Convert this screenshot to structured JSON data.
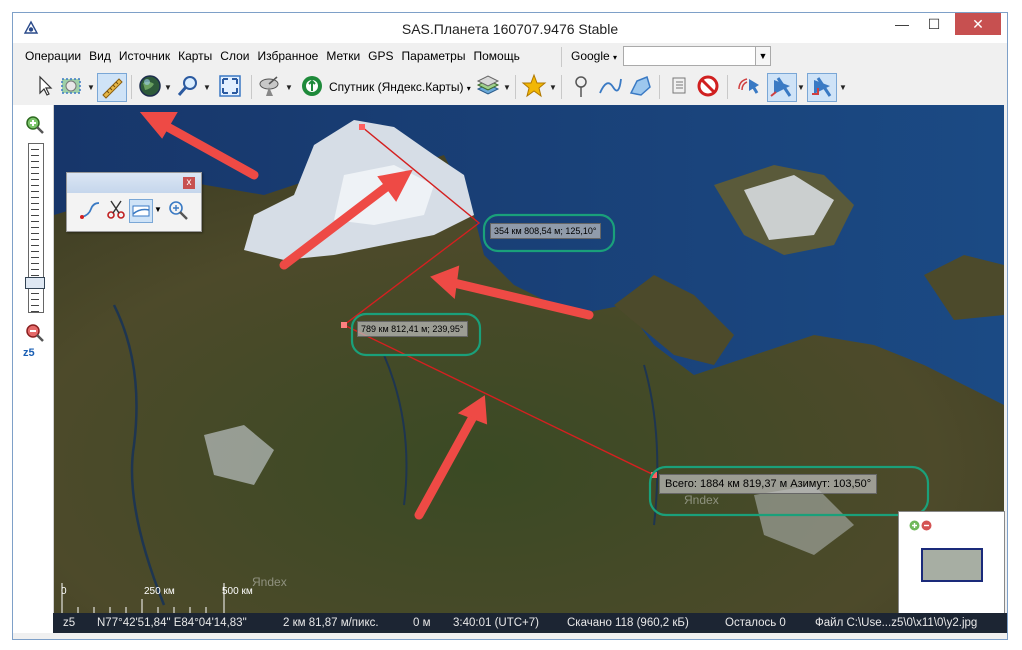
{
  "window": {
    "title": "SAS.Планета 160707.9476 Stable",
    "minimize": "—",
    "maximize": "☐",
    "close": "✕"
  },
  "menu": [
    "Операции",
    "Вид",
    "Источник",
    "Карты",
    "Слои",
    "Избранное",
    "Метки",
    "GPS",
    "Параметры",
    "Помощь"
  ],
  "search": {
    "engine": "Google",
    "value": ""
  },
  "toolbar": {
    "source_label": "Спутник (Яндекс.Карты)"
  },
  "left_panel": {
    "zoom_label": "z5"
  },
  "mini_toolbar": {
    "close": "x"
  },
  "measure": {
    "segment1": "354 км 808,54 м; 125,10°",
    "segment2": "789 км 812,41 м; 239,95°",
    "total": "Всего: 1884 км 819,37 м Азимут: 103,50°"
  },
  "map": {
    "watermark1": "Яndex",
    "watermark2": "Яndex"
  },
  "scale": {
    "labels": [
      "0",
      "250 км",
      "500 км"
    ]
  },
  "status": {
    "zoom": "z5",
    "coords": "N77°42'51,84\" E84°04'14,83\"",
    "resolution": "2 км 81,87 м/пикс.",
    "elevation": "0 м",
    "time": "3:40:01 (UTC+7)",
    "downloaded": "Скачано 118 (960,2 кБ)",
    "remaining": "Осталось 0",
    "file": "Файл C:\\Use...z5\\0\\x11\\0\\y2.jpg"
  },
  "colors": {
    "measure_line": "#d42020",
    "highlight": "#1aa07a",
    "arrow": "#ee4a45",
    "title_close": "#c75050"
  }
}
